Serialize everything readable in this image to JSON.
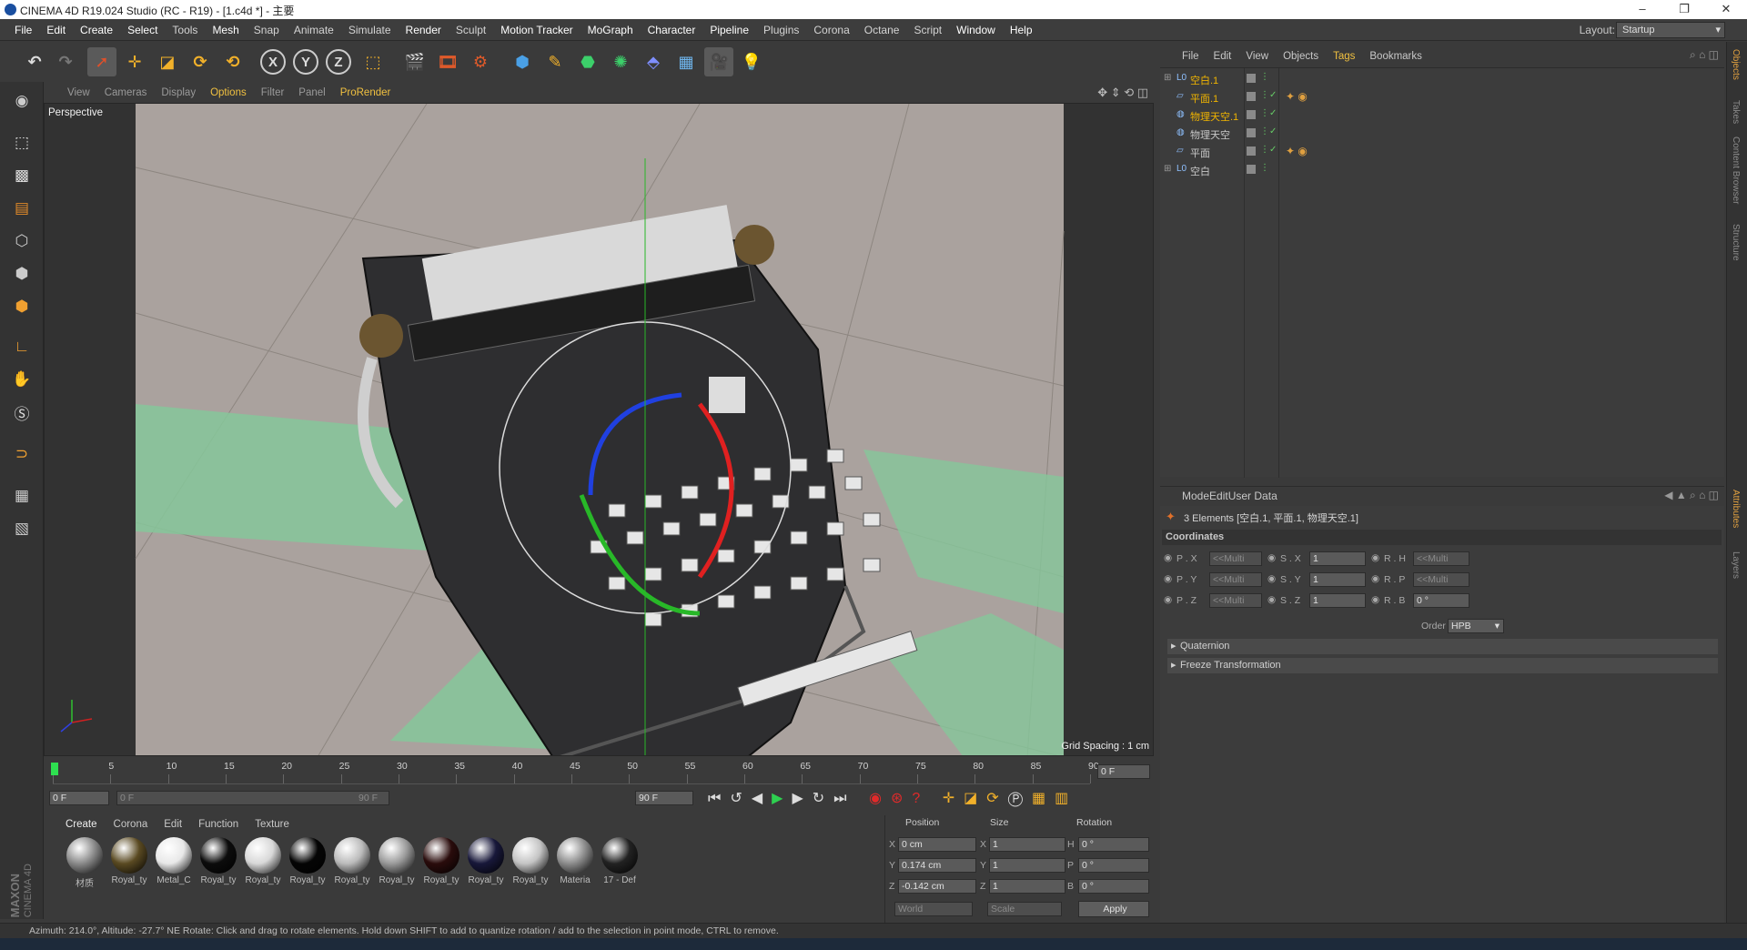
{
  "window": {
    "title": "CINEMA 4D R19.024 Studio (RC - R19) - [1.c4d *] - 主要",
    "minimize": "–",
    "maximize": "❐",
    "close": "✕"
  },
  "menubar": {
    "items": [
      "File",
      "Edit",
      "Create",
      "Select",
      "Tools",
      "Mesh",
      "Snap",
      "Animate",
      "Simulate",
      "Render",
      "Sculpt",
      "Motion Tracker",
      "MoGraph",
      "Character",
      "Pipeline",
      "Plugins",
      "Corona",
      "Octane",
      "Script",
      "Window",
      "Help"
    ],
    "layout_label": "Layout:",
    "layout_value": "Startup"
  },
  "toolbar": {
    "axis_x": "X",
    "axis_y": "Y",
    "axis_z": "Z"
  },
  "viewport": {
    "menu": [
      "View",
      "Cameras",
      "Display",
      "Options",
      "Filter",
      "Panel",
      "ProRender"
    ],
    "label": "Perspective",
    "grid_spacing": "Grid Spacing : 1 cm"
  },
  "objects_panel": {
    "menu": [
      "File",
      "Edit",
      "View",
      "Objects",
      "Tags",
      "Bookmarks"
    ],
    "items": [
      {
        "name": "空白.1",
        "color": "#f0b400"
      },
      {
        "name": "平面.1",
        "color": "#f0b400"
      },
      {
        "name": "物理天空.1",
        "color": "#f0b400"
      },
      {
        "name": "物理天空",
        "color": "#c8c8c8"
      },
      {
        "name": "平面",
        "color": "#c8c8c8"
      },
      {
        "name": "空白",
        "color": "#c8c8c8"
      }
    ]
  },
  "attributes": {
    "menu": [
      "Mode",
      "Edit",
      "User Data"
    ],
    "selection_info": "3 Elements [空白.1, 平面.1, 物理天空.1]",
    "section": "Coordinates",
    "p_labels": [
      "P . X",
      "P . Y",
      "P . Z"
    ],
    "p_values": [
      "<<Multi",
      "<<Multi",
      "<<Multi"
    ],
    "s_labels": [
      "S . X",
      "S . Y",
      "S . Z"
    ],
    "s_values": [
      "1",
      "1",
      "1"
    ],
    "r_labels": [
      "R . H",
      "R . P",
      "R . B"
    ],
    "r_values": [
      "<<Multi",
      "<<Multi",
      "0 °"
    ],
    "order_label": "Order",
    "order_value": "HPB",
    "fold1": "Quaternion",
    "fold2": "Freeze Transformation"
  },
  "right_tabs": [
    "Objects",
    "Takes",
    "Content Browser",
    "Structure",
    "Attributes",
    "Layers"
  ],
  "timeline": {
    "ticks": [
      "0",
      "5",
      "10",
      "15",
      "20",
      "25",
      "30",
      "35",
      "40",
      "45",
      "50",
      "55",
      "60",
      "65",
      "70",
      "75",
      "80",
      "85",
      "90"
    ],
    "current_frame": "0 F",
    "start": "0 F",
    "range_start": "0 F",
    "range_end": "90 F",
    "end": "90 F"
  },
  "materials": {
    "menu": [
      "Create",
      "Corona",
      "Edit",
      "Function",
      "Texture"
    ],
    "items": [
      {
        "label": "材质",
        "color": "#8a8a8a"
      },
      {
        "label": "Royal_ty",
        "color": "#5a4a22"
      },
      {
        "label": "Metal_C",
        "color": "#e8e8e8"
      },
      {
        "label": "Royal_ty",
        "color": "#0c0c0c"
      },
      {
        "label": "Royal_ty",
        "color": "#d8d8d8"
      },
      {
        "label": "Royal_ty",
        "color": "#050505"
      },
      {
        "label": "Royal_ty",
        "color": "#bbbbbb"
      },
      {
        "label": "Royal_ty",
        "color": "#9a9a9a"
      },
      {
        "label": "Royal_ty",
        "color": "#2a0c0c"
      },
      {
        "label": "Royal_ty",
        "color": "#18183a"
      },
      {
        "label": "Royal_ty",
        "color": "#c4c4c4"
      },
      {
        "label": "Materia",
        "color": "#8c8c8c"
      },
      {
        "label": "17 - Def",
        "color": "#222222"
      }
    ]
  },
  "coordinates": {
    "headers": [
      "Position",
      "Size",
      "Rotation"
    ],
    "rows": [
      {
        "axis": "X",
        "pos": "0 cm",
        "size_axis": "X",
        "size": "1",
        "rot_axis": "H",
        "rot": "0 °"
      },
      {
        "axis": "Y",
        "pos": "0.174 cm",
        "size_axis": "Y",
        "size": "1",
        "rot_axis": "P",
        "rot": "0 °"
      },
      {
        "axis": "Z",
        "pos": "-0.142 cm",
        "size_axis": "Z",
        "size": "1",
        "rot_axis": "B",
        "rot": "0 °"
      }
    ],
    "world": "World",
    "scale": "Scale",
    "apply": "Apply"
  },
  "statusbar": {
    "text": "Azimuth: 214.0°, Altitude: -27.7°  NE     Rotate: Click and drag to rotate elements. Hold down SHIFT to add to quantize rotation / add to the selection in point mode, CTRL to remove."
  },
  "branding": {
    "maxon": "MAXON",
    "product": "CINEMA 4D"
  }
}
